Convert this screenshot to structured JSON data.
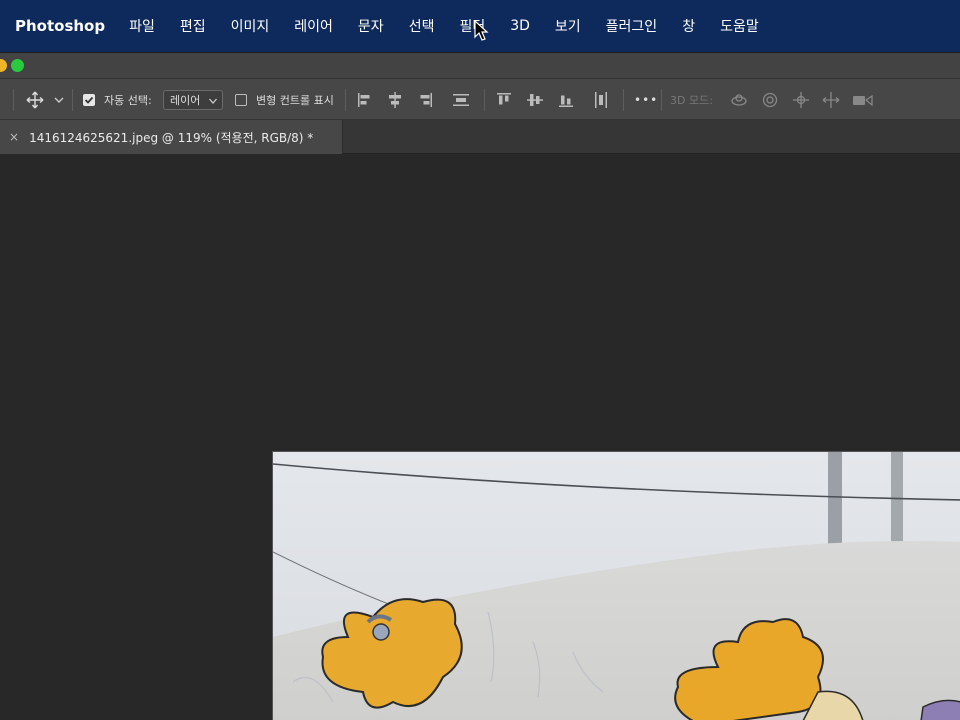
{
  "menubar": {
    "app_name": "Photoshop",
    "items": [
      "파일",
      "편집",
      "이미지",
      "레이어",
      "문자",
      "선택",
      "필터",
      "3D",
      "보기",
      "플러그인",
      "창",
      "도움말"
    ]
  },
  "window": {
    "traffic_colors": [
      "#f0b429",
      "#29c940"
    ]
  },
  "options_bar": {
    "auto_select_label": "자동 선택:",
    "auto_select_checked": true,
    "auto_select_target": "레이어",
    "transform_controls_label": "변형 컨트롤 표시",
    "transform_controls_checked": false,
    "more_label": "•••",
    "mode_3d_label": "3D 모드:"
  },
  "tab": {
    "close_glyph": "×",
    "title": "1416124625621.jpeg @ 119% (적용전, RGB/8) *"
  },
  "colors": {
    "menubar_bg": "#0e2a5c",
    "canvas_bg": "#282828",
    "panel_bg": "#474747"
  }
}
